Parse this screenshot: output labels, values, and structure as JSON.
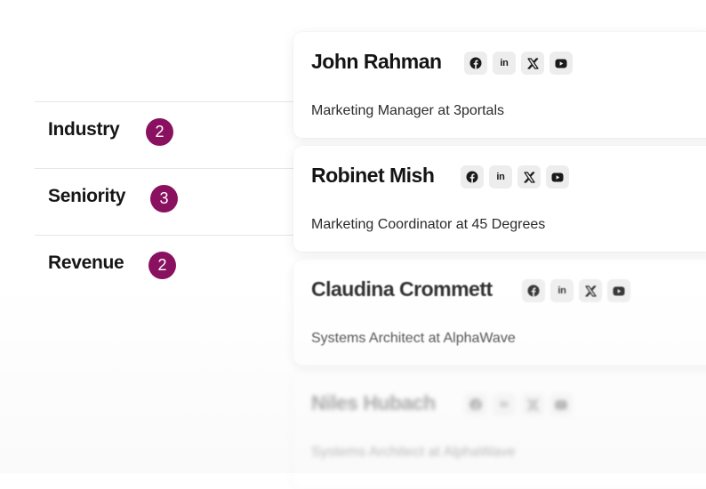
{
  "filters": [
    {
      "label": "Industry",
      "count": "2"
    },
    {
      "label": "Seniority",
      "count": "3"
    },
    {
      "label": "Revenue",
      "count": "2"
    }
  ],
  "cards": [
    {
      "name": "John Rahman",
      "title": "Marketing Manager at 3portals"
    },
    {
      "name": "Robinet Mish",
      "title": "Marketing Coordinator at 45 Degrees"
    },
    {
      "name": "Claudina Crommett",
      "title": "Systems Architect at AlphaWave"
    },
    {
      "name": "Niles Hubach",
      "title": "Systems Architect at AlphaWave"
    }
  ],
  "social_icons": [
    "facebook-icon",
    "linkedin-icon",
    "x-icon",
    "youtube-icon"
  ],
  "colors": {
    "badge": "#8a1060",
    "icon_background": "#ededed"
  }
}
